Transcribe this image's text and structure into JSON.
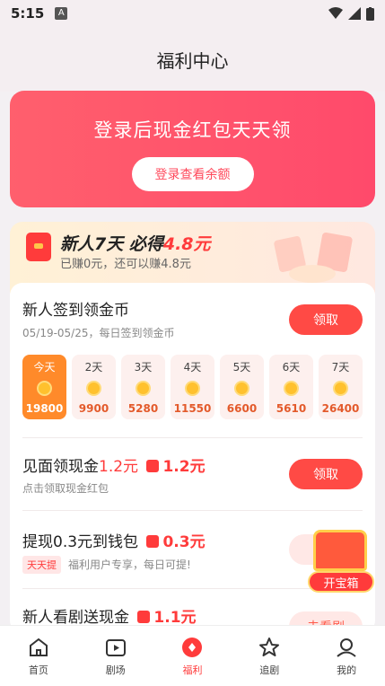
{
  "status_bar": {
    "time": "5:15",
    "notification_icon": "A"
  },
  "header": {
    "title": "福利中心"
  },
  "login_banner": {
    "title": "登录后现金红包天天领",
    "button_label": "登录查看余额"
  },
  "newbie_promo": {
    "headline_prefix": "新人7天 必得",
    "headline_amount": "4.8元",
    "subtitle": "已赚0元，还可以赚4.8元"
  },
  "checkin": {
    "title": "新人签到领金币",
    "subtitle": "05/19-05/25，每日签到领金币",
    "button_label": "领取",
    "days": [
      {
        "label": "今天",
        "points": "19800"
      },
      {
        "label": "2天",
        "points": "9900"
      },
      {
        "label": "3天",
        "points": "5280"
      },
      {
        "label": "4天",
        "points": "11550"
      },
      {
        "label": "5天",
        "points": "6600"
      },
      {
        "label": "6天",
        "points": "5610"
      },
      {
        "label": "7天",
        "points": "26400"
      }
    ]
  },
  "tasks": [
    {
      "title": "见面领现金",
      "amount": "1.2元",
      "reward": "1.2元",
      "subtitle": "点击领取现金红包",
      "button_label": "领取",
      "tag": ""
    },
    {
      "title": "提现0.3元到钱包",
      "amount": "",
      "reward": "0.3元",
      "subtitle": "福利用户专享，每日可提!",
      "button_label": "",
      "tag": "天天提"
    },
    {
      "title": "新人看剧送现金",
      "amount": "",
      "reward": "1.1元",
      "subtitle": "",
      "button_label": "去看剧",
      "tag": ""
    }
  ],
  "treasure_chest": {
    "label": "开宝箱"
  },
  "tab_bar": {
    "items": [
      {
        "label": "首页",
        "icon": "home-icon"
      },
      {
        "label": "剧场",
        "icon": "play-icon"
      },
      {
        "label": "福利",
        "icon": "gift-icon"
      },
      {
        "label": "追剧",
        "icon": "star-icon"
      },
      {
        "label": "我的",
        "icon": "user-icon"
      }
    ],
    "active": "福利"
  },
  "colors": {
    "accent": "#ff3b3b",
    "banner": "#ff5a6a",
    "active_day": "#ff8a2a"
  }
}
